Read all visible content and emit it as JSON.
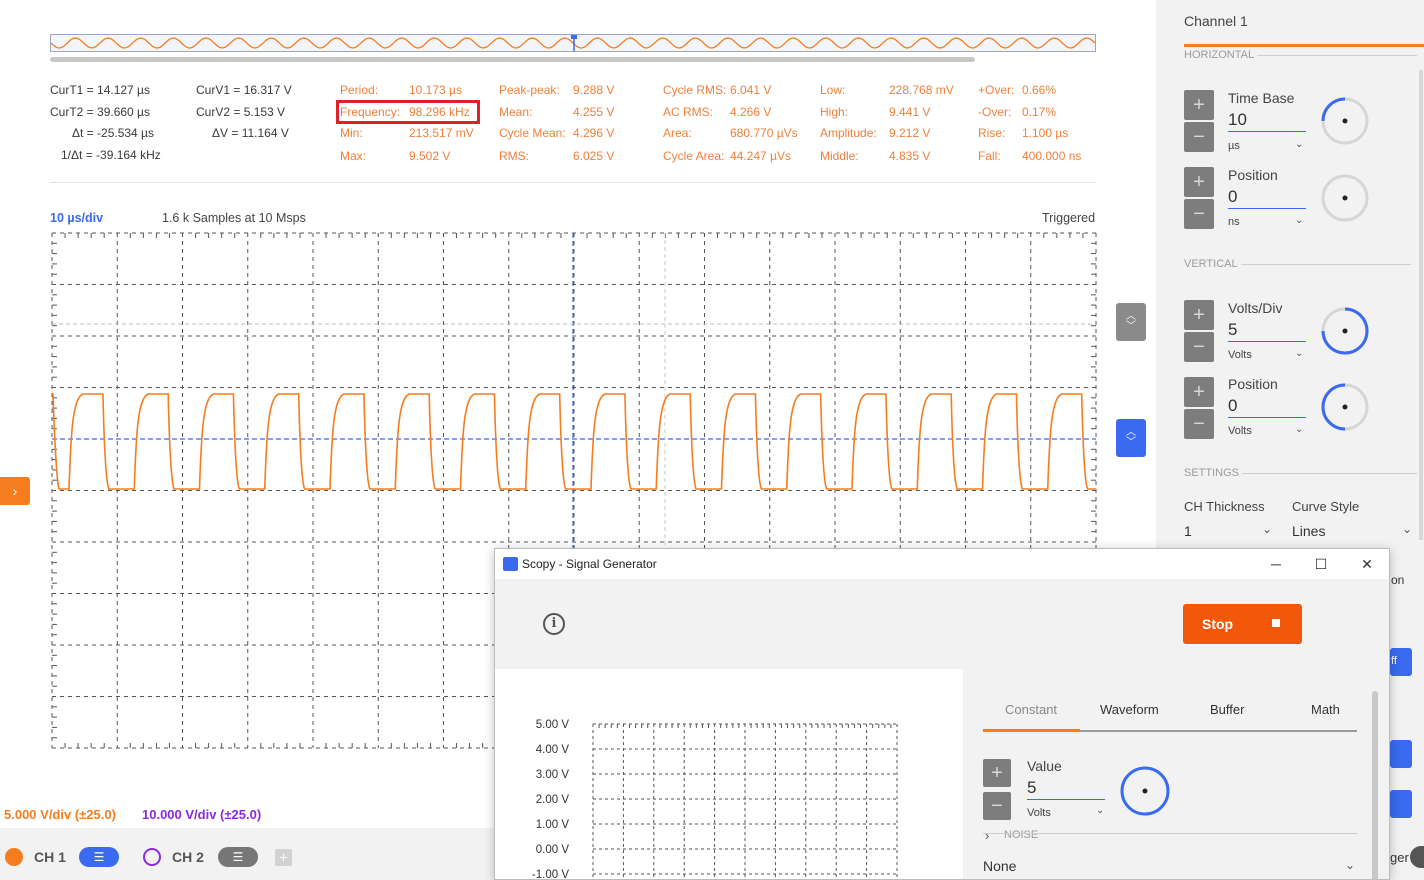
{
  "cursors": {
    "t1": "CurT1 = 14.127 µs",
    "t2": "CurT2 = 39.660 µs",
    "dt": "Δt = -25.534 µs",
    "inv_dt": "1/Δt = -39.164 kHz",
    "v1": "CurV1 = 16.317 V",
    "v2": "CurV2 = 5.153 V",
    "dv": "ΔV = 11.164 V"
  },
  "measurements": [
    {
      "label": "Period:",
      "value": "10.173 µs"
    },
    {
      "label": "Frequency:",
      "value": "98.296 kHz"
    },
    {
      "label": "Min:",
      "value": "213.517 mV"
    },
    {
      "label": "Max:",
      "value": "9.502 V"
    },
    {
      "label": "Peak-peak:",
      "value": "9.288 V"
    },
    {
      "label": "Mean:",
      "value": "4.255 V"
    },
    {
      "label": "Cycle Mean:",
      "value": "4.296 V"
    },
    {
      "label": "RMS:",
      "value": "6.025 V"
    },
    {
      "label": "Cycle RMS:",
      "value": "6.041 V"
    },
    {
      "label": "AC RMS:",
      "value": "4.266 V"
    },
    {
      "label": "Area:",
      "value": "680.770 µVs"
    },
    {
      "label": "Cycle Area:",
      "value": "44.247 µVs"
    },
    {
      "label": "Low:",
      "value": "228.768 mV"
    },
    {
      "label": "High:",
      "value": "9.441 V"
    },
    {
      "label": "Amplitude:",
      "value": "9.212 V"
    },
    {
      "label": "Middle:",
      "value": "4.835 V"
    },
    {
      "label": "+Over:",
      "value": "0.66%"
    },
    {
      "label": "-Over:",
      "value": "0.17%"
    },
    {
      "label": "Rise:",
      "value": "1.100 µs"
    },
    {
      "label": "Fall:",
      "value": "400.000 ns"
    }
  ],
  "plot": {
    "timebase": "10 µs/div",
    "samples": "1.6 k Samples at 10 Msps",
    "status": "Triggered",
    "waveform_cycles": 16
  },
  "channels": {
    "ch1": {
      "label": "CH 1",
      "vdiv": "5.000 V/div (±25.0)",
      "color": "#f57c1f"
    },
    "ch2": {
      "label": "CH 2",
      "vdiv": "10.000 V/div (±25.0)",
      "color": "#8a2be2"
    }
  },
  "panel": {
    "title": "Channel 1",
    "horizontal_header": "HORIZONTAL",
    "vertical_header": "VERTICAL",
    "settings_header": "SETTINGS",
    "time_base": {
      "label": "Time Base",
      "value": "10",
      "unit": "µs"
    },
    "h_position": {
      "label": "Position",
      "value": "0",
      "unit": "ns"
    },
    "volts_div": {
      "label": "Volts/Div",
      "value": "5",
      "unit": "Volts"
    },
    "v_position": {
      "label": "Position",
      "value": "0",
      "unit": "Volts"
    },
    "ch_thickness": {
      "label": "CH Thickness",
      "value": "1"
    },
    "curve_style": {
      "label": "Curve Style",
      "value": "Lines"
    },
    "fragments": {
      "a": "on",
      "b": "ff",
      "c": "ger"
    }
  },
  "siggen": {
    "title": "Scopy - Signal Generator",
    "stop_label": "Stop",
    "tabs": [
      "Constant",
      "Waveform",
      "Buffer",
      "Math"
    ],
    "value": {
      "label": "Value",
      "value": "5",
      "unit": "Volts"
    },
    "noise_header": "NOISE",
    "noise_value": "None",
    "y_ticks": [
      "5.00 V",
      "4.00 V",
      "3.00 V",
      "2.00 V",
      "1.00 V",
      "0.00 V",
      "-1.00 V"
    ]
  },
  "colors": {
    "accent_orange": "#f57c1f",
    "accent_blue": "#3a6af0",
    "measure_orange": "#f07f3a",
    "highlight_red": "#e01f26",
    "stop_orange": "#f3570c"
  }
}
